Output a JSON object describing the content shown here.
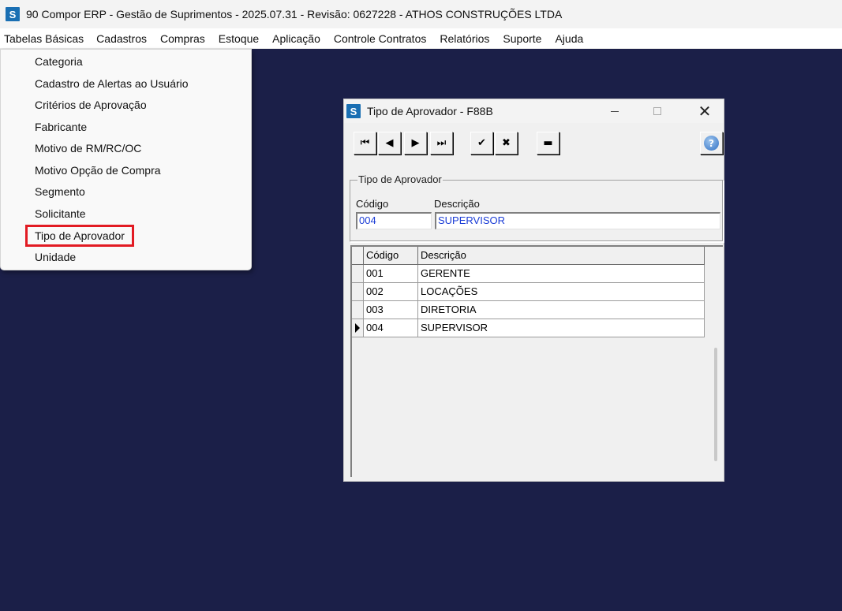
{
  "app": {
    "icon_letter": "S",
    "title": "90 Compor ERP - Gestão de Suprimentos - 2025.07.31 - Revisão: 0627228 - ATHOS CONSTRUÇÕES LTDA"
  },
  "menubar": {
    "items": [
      "Tabelas Básicas",
      "Cadastros",
      "Compras",
      "Estoque",
      "Aplicação",
      "Controle Contratos",
      "Relatórios",
      "Suporte",
      "Ajuda"
    ]
  },
  "dropdown": {
    "items": [
      "Categoria",
      "Cadastro de Alertas ao Usuário",
      "Critérios de Aprovação",
      "Fabricante",
      "Motivo de RM/RC/OC",
      "Motivo Opção de Compra",
      "Segmento",
      "Solicitante",
      "Tipo de Aprovador",
      "Unidade"
    ],
    "highlighted": "Tipo de Aprovador",
    "highlight_color": "#e21b23"
  },
  "dialog": {
    "icon_letter": "S",
    "title": "Tipo de Aprovador - F88B",
    "toolbar": {
      "first_icon": "⏮",
      "prev_icon": "◀",
      "next_icon": "▶",
      "last_icon": "⏭",
      "confirm_icon": "✔",
      "cancel_icon": "✖",
      "delete_icon": "▬",
      "help_icon": "?"
    },
    "group": {
      "legend": "Tipo de Aprovador",
      "codigo_label": "Código",
      "descricao_label": "Descrição",
      "codigo_value": "004",
      "descricao_value": "SUPERVISOR"
    },
    "grid": {
      "headers": [
        "Código",
        "Descrição"
      ],
      "rows": [
        {
          "codigo": "001",
          "descricao": "GERENTE"
        },
        {
          "codigo": "002",
          "descricao": "LOCAÇÕES"
        },
        {
          "codigo": "003",
          "descricao": "DIRETORIA"
        },
        {
          "codigo": "004",
          "descricao": "SUPERVISOR"
        }
      ],
      "current_row": 3
    }
  },
  "colors": {
    "desktop": "#1b1f48",
    "field_text": "#1a3cd6",
    "app_icon": "#1a6fb3"
  }
}
